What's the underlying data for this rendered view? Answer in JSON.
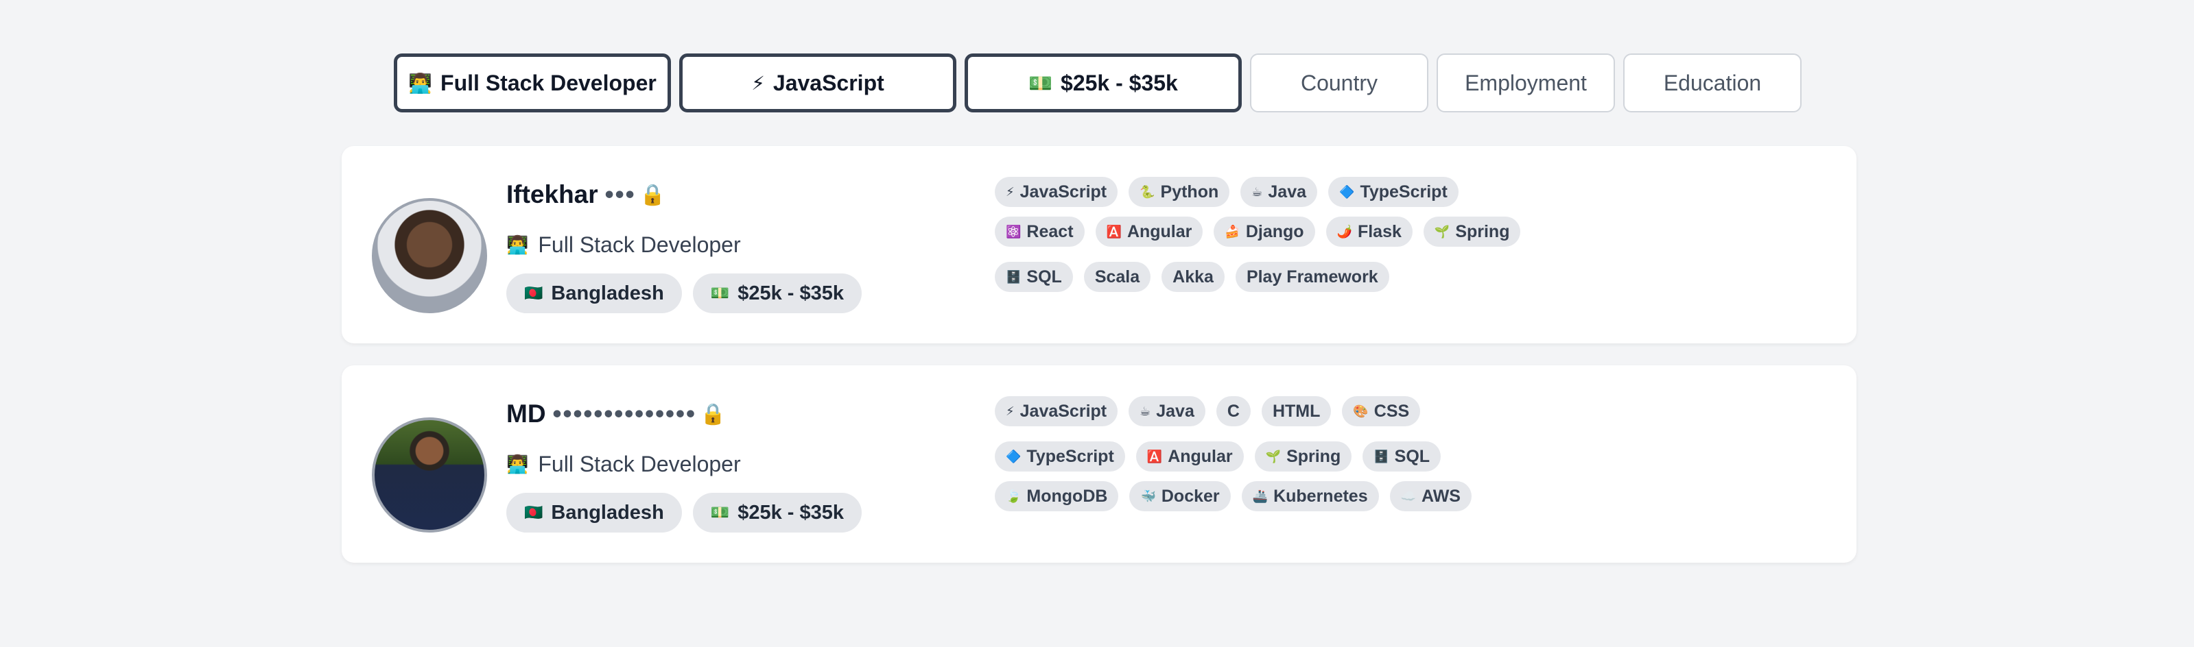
{
  "filters": [
    {
      "icon": "👨‍💻",
      "label": "Full Stack Developer",
      "active": true
    },
    {
      "icon": "⚡",
      "label": "JavaScript",
      "active": true
    },
    {
      "icon": "💵",
      "label": "$25k - $35k",
      "active": true
    },
    {
      "icon": "",
      "label": "Country",
      "active": false
    },
    {
      "icon": "",
      "label": "Employment",
      "active": false
    },
    {
      "icon": "",
      "label": "Education",
      "active": false
    }
  ],
  "candidates": [
    {
      "name": "Iftekhar",
      "masked": "•••",
      "lock": "🔒",
      "role_icon": "👨‍💻",
      "role": "Full Stack Developer",
      "country_icon": "🇧🇩",
      "country": "Bangladesh",
      "salary_icon": "💵",
      "salary": "$25k - $35k",
      "skill_rows": [
        [
          {
            "icon": "⚡",
            "label": "JavaScript"
          },
          {
            "icon": "🐍",
            "label": "Python"
          },
          {
            "icon": "☕",
            "label": "Java"
          },
          {
            "icon": "🔷",
            "label": "TypeScript"
          }
        ],
        [
          {
            "icon": "⚛️",
            "label": "React"
          },
          {
            "icon": "🅰️",
            "label": "Angular"
          },
          {
            "icon": "🍰",
            "label": "Django"
          },
          {
            "icon": "🌶️",
            "label": "Flask"
          },
          {
            "icon": "🌱",
            "label": "Spring"
          }
        ],
        [
          {
            "icon": "🗄️",
            "label": "SQL"
          },
          {
            "icon": "",
            "label": "Scala"
          },
          {
            "icon": "",
            "label": "Akka"
          },
          {
            "icon": "",
            "label": "Play Framework"
          }
        ]
      ]
    },
    {
      "name": "MD",
      "masked": "••••••••••••••",
      "lock": "🔒",
      "role_icon": "👨‍💻",
      "role": "Full Stack Developer",
      "country_icon": "🇧🇩",
      "country": "Bangladesh",
      "salary_icon": "💵",
      "salary": "$25k - $35k",
      "skill_rows": [
        [
          {
            "icon": "⚡",
            "label": "JavaScript"
          },
          {
            "icon": "☕",
            "label": "Java"
          },
          {
            "icon": "",
            "label": "C"
          },
          {
            "icon": "",
            "label": "HTML"
          },
          {
            "icon": "🎨",
            "label": "CSS"
          }
        ],
        [
          {
            "icon": "🔷",
            "label": "TypeScript"
          },
          {
            "icon": "🅰️",
            "label": "Angular"
          },
          {
            "icon": "🌱",
            "label": "Spring"
          },
          {
            "icon": "🗄️",
            "label": "SQL"
          }
        ],
        [
          {
            "icon": "🍃",
            "label": "MongoDB"
          },
          {
            "icon": "🐳",
            "label": "Docker"
          },
          {
            "icon": "🚢",
            "label": "Kubernetes"
          },
          {
            "icon": "☁️",
            "label": "AWS"
          }
        ]
      ]
    }
  ]
}
